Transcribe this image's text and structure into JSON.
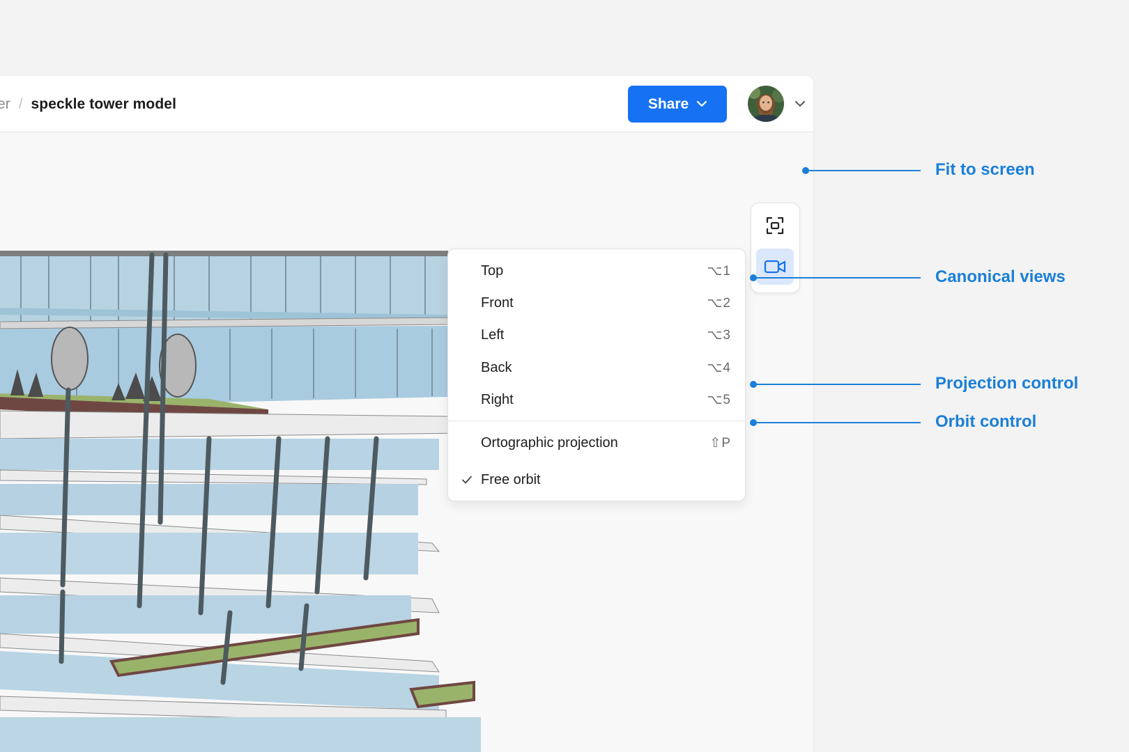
{
  "breadcrumb": {
    "previous": "er",
    "separator": "/",
    "current": "speckle tower model"
  },
  "header": {
    "share_label": "Share"
  },
  "colors": {
    "accent": "#1672f3",
    "callout": "#1a7fd8"
  },
  "toolbar": {
    "fit_icon": "fit-to-screen-icon",
    "camera_icon": "video-camera-icon"
  },
  "menu": {
    "views": [
      {
        "label": "Top",
        "shortcut": "⌥1"
      },
      {
        "label": "Front",
        "shortcut": "⌥2"
      },
      {
        "label": "Left",
        "shortcut": "⌥3"
      },
      {
        "label": "Back",
        "shortcut": "⌥4"
      },
      {
        "label": "Right",
        "shortcut": "⌥5"
      }
    ],
    "projection": {
      "label": "Ortographic projection",
      "shortcut": "⇧P"
    },
    "orbit": {
      "label": "Free orbit",
      "checked": true
    }
  },
  "callouts": [
    "Fit to screen",
    "Canonical views",
    "Projection control",
    "Orbit control"
  ]
}
